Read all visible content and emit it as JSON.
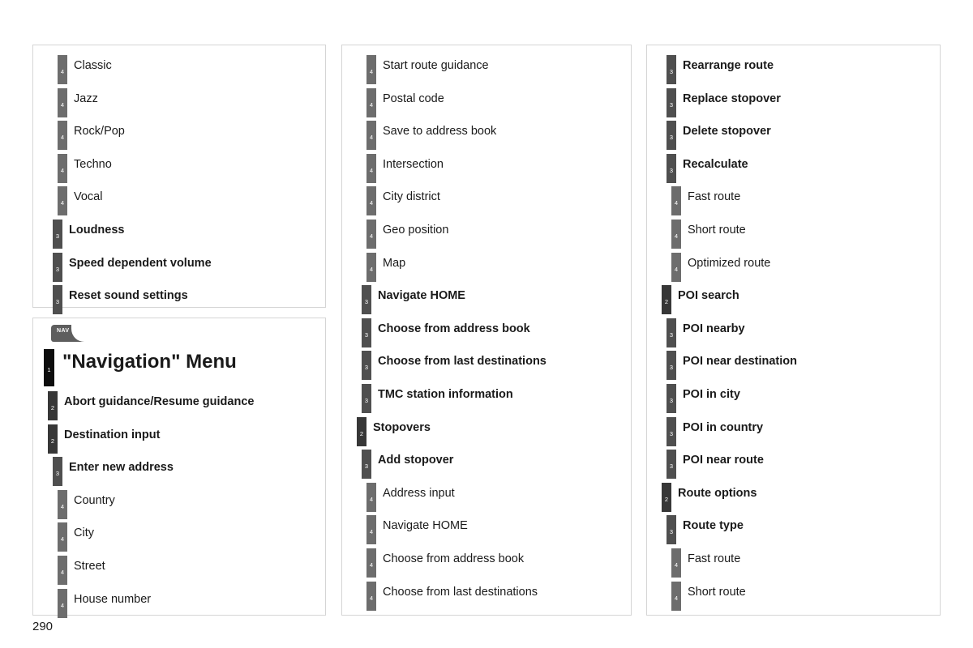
{
  "page": {
    "number": "290",
    "level_colors": {
      "level1": "#0d0d0d",
      "level2": "#373737",
      "level3": "#4f4f4f",
      "level4": "#6d6d6d"
    }
  },
  "panels": [
    {
      "id": "panel-audio",
      "name": "audio-sound-settings-panel",
      "items": [
        {
          "level": 4,
          "label": "Classic"
        },
        {
          "level": 4,
          "label": "Jazz"
        },
        {
          "level": 4,
          "label": "Rock/Pop"
        },
        {
          "level": 4,
          "label": "Techno"
        },
        {
          "level": 4,
          "label": "Vocal"
        },
        {
          "level": 3,
          "label": "Loudness"
        },
        {
          "level": 3,
          "label": "Speed dependent volume"
        },
        {
          "level": 3,
          "label": "Reset sound settings"
        }
      ]
    },
    {
      "id": "panel-navigation",
      "name": "navigation-menu-panel",
      "badge": {
        "icon": "nav-button-icon",
        "label": "NAV"
      },
      "items": [
        {
          "level": 1,
          "label": "\"Navigation\" Menu"
        },
        {
          "level": 2,
          "label": "Abort guidance/Resume guidance"
        },
        {
          "level": 2,
          "label": "Destination input"
        },
        {
          "level": 3,
          "label": "Enter new address"
        },
        {
          "level": 4,
          "label": "Country"
        },
        {
          "level": 4,
          "label": "City"
        },
        {
          "level": 4,
          "label": "Street"
        },
        {
          "level": 4,
          "label": "House number"
        }
      ]
    },
    {
      "id": "panel-middle",
      "name": "navigation-destination-panel",
      "items": [
        {
          "level": 4,
          "label": "Start route guidance"
        },
        {
          "level": 4,
          "label": "Postal code"
        },
        {
          "level": 4,
          "label": "Save to address book"
        },
        {
          "level": 4,
          "label": "Intersection"
        },
        {
          "level": 4,
          "label": "City district"
        },
        {
          "level": 4,
          "label": "Geo position"
        },
        {
          "level": 4,
          "label": "Map"
        },
        {
          "level": 3,
          "label": "Navigate HOME"
        },
        {
          "level": 3,
          "label": "Choose from address book"
        },
        {
          "level": 3,
          "label": "Choose from last destinations"
        },
        {
          "level": 3,
          "label": "TMC station information"
        },
        {
          "level": 2,
          "label": "Stopovers"
        },
        {
          "level": 3,
          "label": "Add stopover"
        },
        {
          "level": 4,
          "label": "Address input"
        },
        {
          "level": 4,
          "label": "Navigate HOME"
        },
        {
          "level": 4,
          "label": "Choose from address book"
        },
        {
          "level": 4,
          "label": "Choose from last destinations"
        }
      ]
    },
    {
      "id": "panel-right",
      "name": "navigation-route-poi-panel",
      "items": [
        {
          "level": 3,
          "label": "Rearrange route"
        },
        {
          "level": 3,
          "label": "Replace stopover"
        },
        {
          "level": 3,
          "label": "Delete stopover"
        },
        {
          "level": 3,
          "label": "Recalculate"
        },
        {
          "level": 4,
          "label": "Fast route"
        },
        {
          "level": 4,
          "label": "Short route"
        },
        {
          "level": 4,
          "label": "Optimized route"
        },
        {
          "level": 2,
          "label": "POI search"
        },
        {
          "level": 3,
          "label": "POI nearby"
        },
        {
          "level": 3,
          "label": "POI near destination"
        },
        {
          "level": 3,
          "label": "POI in city"
        },
        {
          "level": 3,
          "label": "POI in country"
        },
        {
          "level": 3,
          "label": "POI near route"
        },
        {
          "level": 2,
          "label": "Route options"
        },
        {
          "level": 3,
          "label": "Route type"
        },
        {
          "level": 4,
          "label": "Fast route"
        },
        {
          "level": 4,
          "label": "Short route"
        }
      ]
    }
  ]
}
